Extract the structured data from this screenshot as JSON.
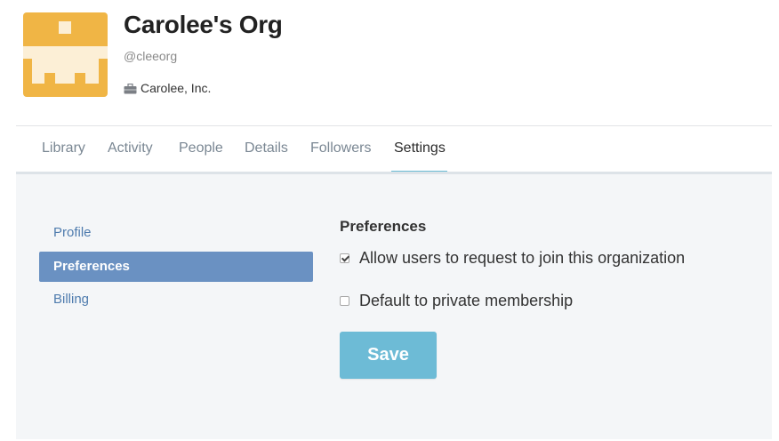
{
  "org": {
    "name": "Carolee's Org",
    "handle": "@cleeorg",
    "company": "Carolee, Inc.",
    "avatar_color": "#f0b545",
    "company_icon": "briefcase-icon"
  },
  "tabs": [
    {
      "label": "Library"
    },
    {
      "label": "Activity"
    },
    {
      "label": "People"
    },
    {
      "label": "Details"
    },
    {
      "label": "Followers"
    },
    {
      "label": "Settings",
      "active": true
    }
  ],
  "sidebar": {
    "items": [
      {
        "label": "Profile"
      },
      {
        "label": "Preferences",
        "active": true
      },
      {
        "label": "Billing"
      }
    ]
  },
  "preferences": {
    "title": "Preferences",
    "options": [
      {
        "label": "Allow users to request to join this organization",
        "checked": true
      },
      {
        "label": "Default to private membership",
        "checked": false
      }
    ],
    "save_label": "Save"
  },
  "colors": {
    "accent": "#6dbbd6",
    "sidebar_active": "#6a91c2",
    "link": "#4f7cae"
  }
}
